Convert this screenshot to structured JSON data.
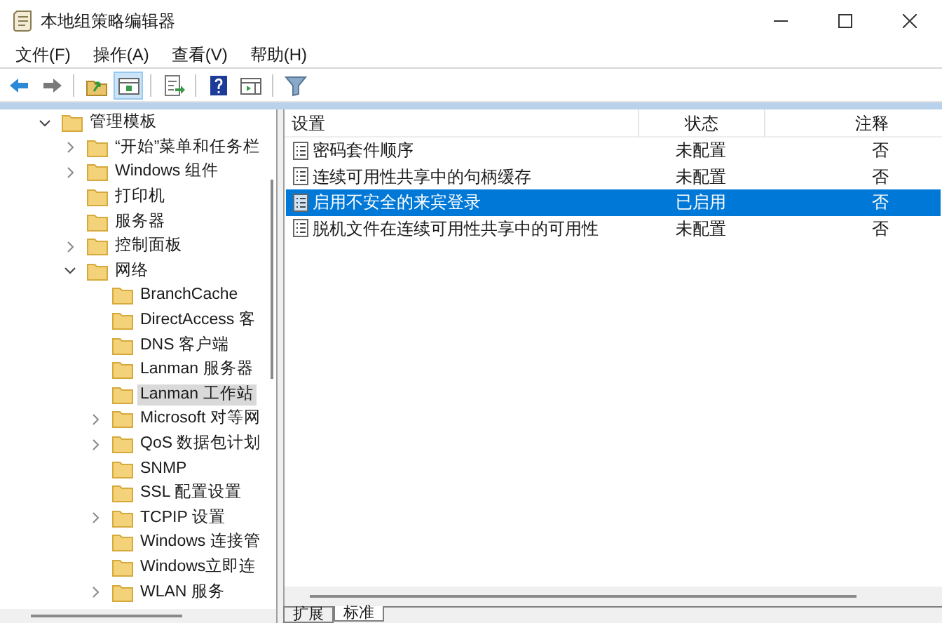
{
  "window": {
    "title": "本地组策略编辑器"
  },
  "menu": [
    "文件(F)",
    "操作(A)",
    "查看(V)",
    "帮助(H)"
  ],
  "toolbar": [
    {
      "kind": "back",
      "pressed": false
    },
    {
      "kind": "forward",
      "pressed": false
    },
    {
      "kind": "sep"
    },
    {
      "kind": "up",
      "pressed": false
    },
    {
      "kind": "tree",
      "pressed": true
    },
    {
      "kind": "sep"
    },
    {
      "kind": "export",
      "pressed": false
    },
    {
      "kind": "sep"
    },
    {
      "kind": "help",
      "pressed": false
    },
    {
      "kind": "pane",
      "pressed": false
    },
    {
      "kind": "sep"
    },
    {
      "kind": "filter",
      "pressed": false
    }
  ],
  "tree": [
    {
      "label": "管理模板",
      "expanded": true,
      "selected": false,
      "children": [
        {
          "label": "“开始”菜单和任务栏",
          "expanded": false,
          "selected": false
        },
        {
          "label": "Windows 组件",
          "expanded": false,
          "selected": false
        },
        {
          "label": "打印机",
          "selected": false
        },
        {
          "label": "服务器",
          "selected": false
        },
        {
          "label": "控制面板",
          "expanded": false,
          "selected": false
        },
        {
          "label": "网络",
          "expanded": true,
          "selected": false,
          "children": [
            {
              "label": "BranchCache",
              "selected": false
            },
            {
              "label": "DirectAccess 客",
              "selected": false
            },
            {
              "label": "DNS 客户端",
              "selected": false
            },
            {
              "label": "Lanman 服务器",
              "selected": false
            },
            {
              "label": "Lanman 工作站",
              "selected": true
            },
            {
              "label": "Microsoft 对等网",
              "expanded": false,
              "selected": false
            },
            {
              "label": "QoS 数据包计划",
              "expanded": false,
              "selected": false
            },
            {
              "label": "SNMP",
              "selected": false
            },
            {
              "label": "SSL 配置设置",
              "selected": false
            },
            {
              "label": "TCPIP 设置",
              "expanded": false,
              "selected": false
            },
            {
              "label": "Windows 连接管",
              "selected": false
            },
            {
              "label": "Windows立即连",
              "selected": false
            },
            {
              "label": "WLAN 服务",
              "expanded": false,
              "selected": false
            }
          ]
        }
      ]
    }
  ],
  "table": {
    "columns": [
      "设置",
      "状态",
      "注释"
    ],
    "rows": [
      {
        "setting": "密码套件顺序",
        "state": "未配置",
        "comment": "否",
        "selected": false
      },
      {
        "setting": "连续可用性共享中的句柄缓存",
        "state": "未配置",
        "comment": "否",
        "selected": false
      },
      {
        "setting": "启用不安全的来宾登录",
        "state": "已启用",
        "comment": "否",
        "selected": true
      },
      {
        "setting": "脱机文件在连续可用性共享中的可用性",
        "state": "未配置",
        "comment": "否",
        "selected": false
      }
    ]
  },
  "tabs": [
    {
      "label": "扩展",
      "selected": false
    },
    {
      "label": "标准",
      "selected": true
    }
  ]
}
